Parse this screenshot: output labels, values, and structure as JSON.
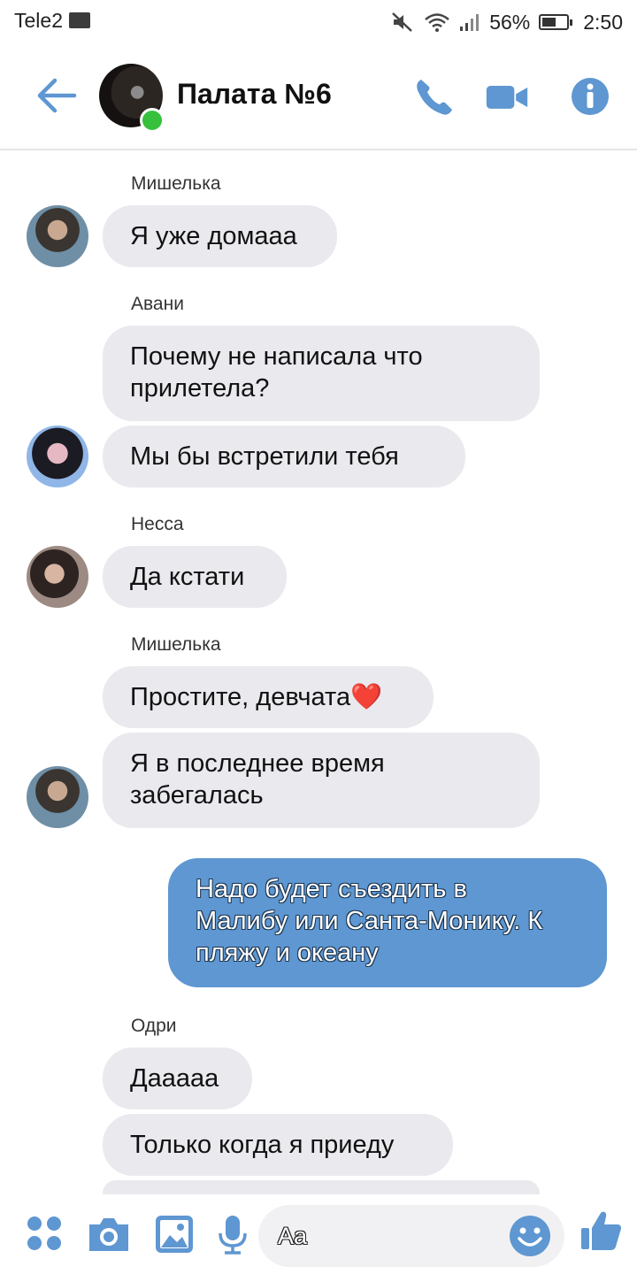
{
  "status_bar": {
    "carrier": "Tele2",
    "battery": "56%",
    "time": "2:50",
    "battery_level": 0.56
  },
  "header": {
    "title": "Палата №6"
  },
  "messages": [
    {
      "sender": "Мишелька",
      "texts": [
        "Я уже домааа"
      ]
    },
    {
      "sender": "Авани",
      "texts": [
        "Почему не написала что\nприлетела?",
        "Мы бы встретили тебя"
      ]
    },
    {
      "sender": "Несса",
      "texts": [
        "Да кстати"
      ]
    },
    {
      "sender": "Мишелька",
      "texts": [
        "Простите, девчата❤️",
        "Я в последнее время\nзабегалась"
      ]
    },
    {
      "sender": "",
      "outgoing": true,
      "texts": [
        "Надо будет съездить в\nМалибу или Санта-Монику. К\nпляжу и океану"
      ]
    },
    {
      "sender": "Одри",
      "texts": [
        "Дааааа",
        "Только когда я приеду"
      ]
    }
  ],
  "composer": {
    "placeholder": "Aa"
  },
  "colors": {
    "accent": "#5e97d1",
    "incoming_bubble": "#e9e9ee",
    "online": "#36c03c"
  }
}
